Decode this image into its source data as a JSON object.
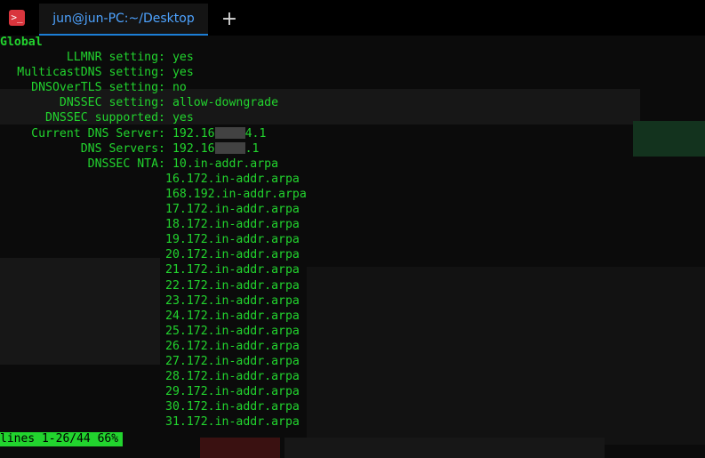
{
  "window": {
    "tab_title": "jun@jun-PC:~/Desktop",
    "new_tab_symbol": "+",
    "app_icon_glyph": ">_"
  },
  "terminal": {
    "header": "Global",
    "settings": [
      {
        "key": "LLMNR setting:",
        "value": "yes"
      },
      {
        "key": "MulticastDNS setting:",
        "value": "yes"
      },
      {
        "key": "DNSOverTLS setting:",
        "value": "no"
      },
      {
        "key": "DNSSEC setting:",
        "value": "allow-downgrade"
      },
      {
        "key": "DNSSEC supported:",
        "value": "yes"
      },
      {
        "key": "Current DNS Server:",
        "value_prefix": "192.16",
        "value_suffix": "4.1"
      },
      {
        "key": "DNS Servers:",
        "value_prefix": "192.16",
        "value_suffix": ".1"
      },
      {
        "key": "DNSSEC NTA:",
        "value": "10.in-addr.arpa"
      }
    ],
    "nta_continuation": [
      "16.172.in-addr.arpa",
      "168.192.in-addr.arpa",
      "17.172.in-addr.arpa",
      "18.172.in-addr.arpa",
      "19.172.in-addr.arpa",
      "20.172.in-addr.arpa",
      "21.172.in-addr.arpa",
      "22.172.in-addr.arpa",
      "23.172.in-addr.arpa",
      "24.172.in-addr.arpa",
      "25.172.in-addr.arpa",
      "26.172.in-addr.arpa",
      "27.172.in-addr.arpa",
      "28.172.in-addr.arpa",
      "29.172.in-addr.arpa",
      "30.172.in-addr.arpa",
      "31.172.in-addr.arpa"
    ],
    "status": "lines 1-26/44 66%"
  },
  "colors": {
    "terminal_text": "#22d42e",
    "tab_text": "#4ea3ff",
    "tab_underline": "#1c7ed6",
    "app_icon_bg": "#d9353d"
  }
}
